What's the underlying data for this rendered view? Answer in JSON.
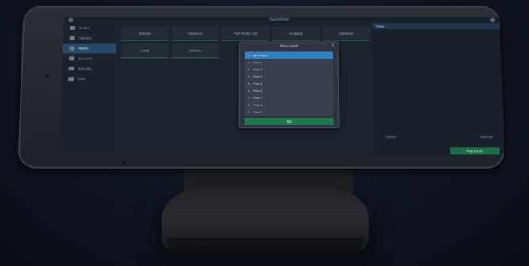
{
  "app": {
    "brand": "TouchPoint"
  },
  "sidebar": {
    "items": [
      {
        "label": "Drinks",
        "icon": "drink-icon",
        "active": false
      },
      {
        "label": "Starters",
        "icon": "starter-icon",
        "active": false
      },
      {
        "label": "Mains",
        "icon": "mains-icon",
        "active": true
      },
      {
        "label": "Desserts",
        "icon": "dessert-icon",
        "active": false
      },
      {
        "label": "Specials",
        "icon": "specials-icon",
        "active": false
      },
      {
        "label": "Lists",
        "icon": "list-icon",
        "active": false
      }
    ]
  },
  "menu": {
    "row1": [
      "Salmon",
      "Haddock",
      "Puff Pastry Tart",
      "Scallops",
      "Gammon"
    ],
    "row2": [
      "Lamb",
      "Venison"
    ]
  },
  "order": {
    "header": "Table",
    "cancel_label": "Cancel",
    "discount_label": "Discount",
    "pay_label": "Pay £0.00"
  },
  "modal": {
    "title": "Price Level",
    "close_glyph": "✕",
    "options": [
      "1 - Std Prices",
      "2 - Price 2",
      "3 - Price 3",
      "4 - Price 4",
      "5 - Price 5",
      "6 - Price 6",
      "7 - Price 7",
      "8 - Price 8",
      "9 - Price 9"
    ],
    "selected_index": 0,
    "set_label": "Set"
  },
  "colors": {
    "accent": "#2f7fc2",
    "success": "#1f7a4b",
    "active_nav": "#274a6a"
  }
}
